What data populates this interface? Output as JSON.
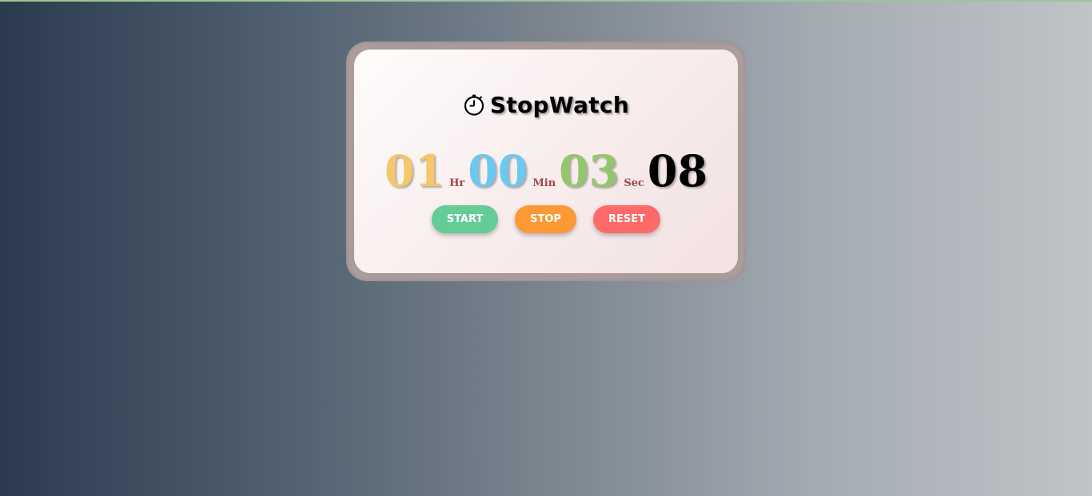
{
  "app": {
    "title": "StopWatch",
    "title_icon": "stopwatch-icon"
  },
  "display": {
    "hours": "01",
    "hours_unit": "Hr",
    "minutes": "00",
    "minutes_unit": "Min",
    "seconds": "03",
    "seconds_unit": "Sec",
    "milliseconds": "08"
  },
  "controls": {
    "start_label": "START",
    "stop_label": "STOP",
    "reset_label": "RESET"
  },
  "colors": {
    "hours": "#f6c66b",
    "minutes": "#6cc7f1",
    "seconds": "#92c76e",
    "milliseconds": "#000000",
    "unit": "#a04747",
    "start": "#64cc95",
    "stop": "#fb9935",
    "reset": "#fe6a68"
  }
}
